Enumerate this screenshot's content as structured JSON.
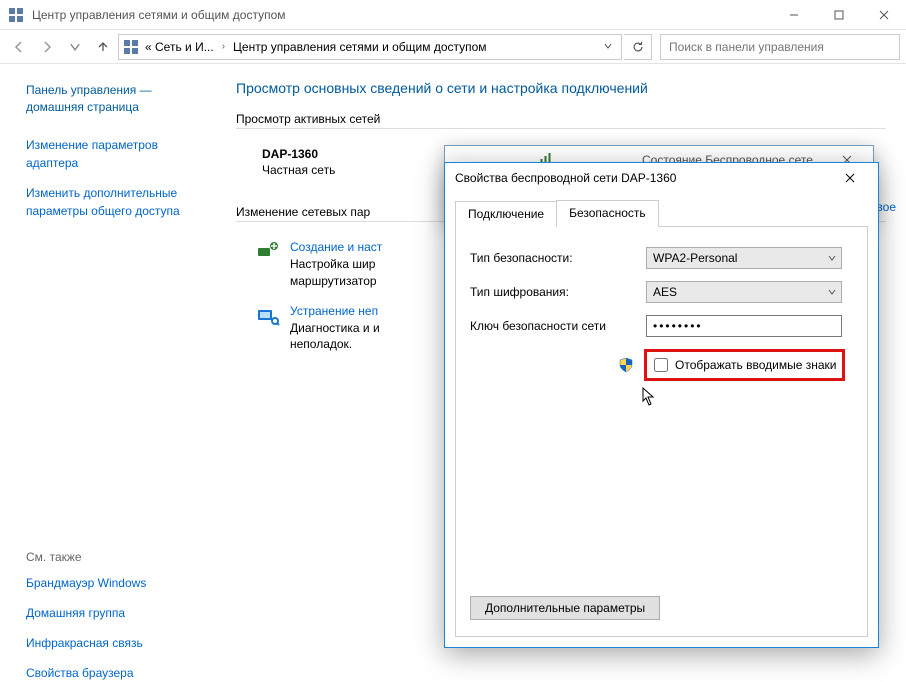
{
  "window": {
    "title": "Центр управления сетями и общим доступом"
  },
  "breadcrumb": {
    "part1": "« Сеть и И...",
    "part2": "Центр управления сетями и общим доступом"
  },
  "search": {
    "placeholder": "Поиск в панели управления"
  },
  "sidebar": {
    "home1": "Панель управления —",
    "home2": "домашняя страница",
    "link_adapter1": "Изменение параметров",
    "link_adapter2": "адаптера",
    "link_sharing1": "Изменить дополнительные",
    "link_sharing2": "параметры общего доступа",
    "see_also_label": "См. также",
    "see_also": {
      "firewall": "Брандмауэр Windows",
      "homegroup": "Домашняя группа",
      "infrared": "Инфракрасная связь",
      "browser": "Свойства браузера"
    }
  },
  "content": {
    "heading": "Просмотр основных сведений о сети и настройка подключений",
    "active_nets_label": "Просмотр активных сетей",
    "net_name": "DAP-1360",
    "net_type": "Частная сеть",
    "change_label": "Изменение сетевых пар",
    "task_create_title": "Создание и наст",
    "task_create_desc1": "Настройка шир",
    "task_create_desc2": "маршрутизатор",
    "task_trouble_title": "Устранение неп",
    "task_trouble_desc1": "Диагностика и и",
    "task_trouble_desc2": "неполадок.",
    "peek_link": "вое"
  },
  "status_window": {
    "title": "Состояние   Беспроводное сетевое соединение"
  },
  "dialog": {
    "title": "Свойства беспроводной сети DAP-1360",
    "tab_connection": "Подключение",
    "tab_security": "Безопасность",
    "lbl_sectype": "Тип безопасности:",
    "val_sectype": "WPA2-Personal",
    "lbl_enc": "Тип шифрования:",
    "val_enc": "AES",
    "lbl_key": "Ключ безопасности сети",
    "val_key": "••••••••",
    "show_chars": "Отображать вводимые знаки",
    "advanced": "Дополнительные параметры"
  }
}
